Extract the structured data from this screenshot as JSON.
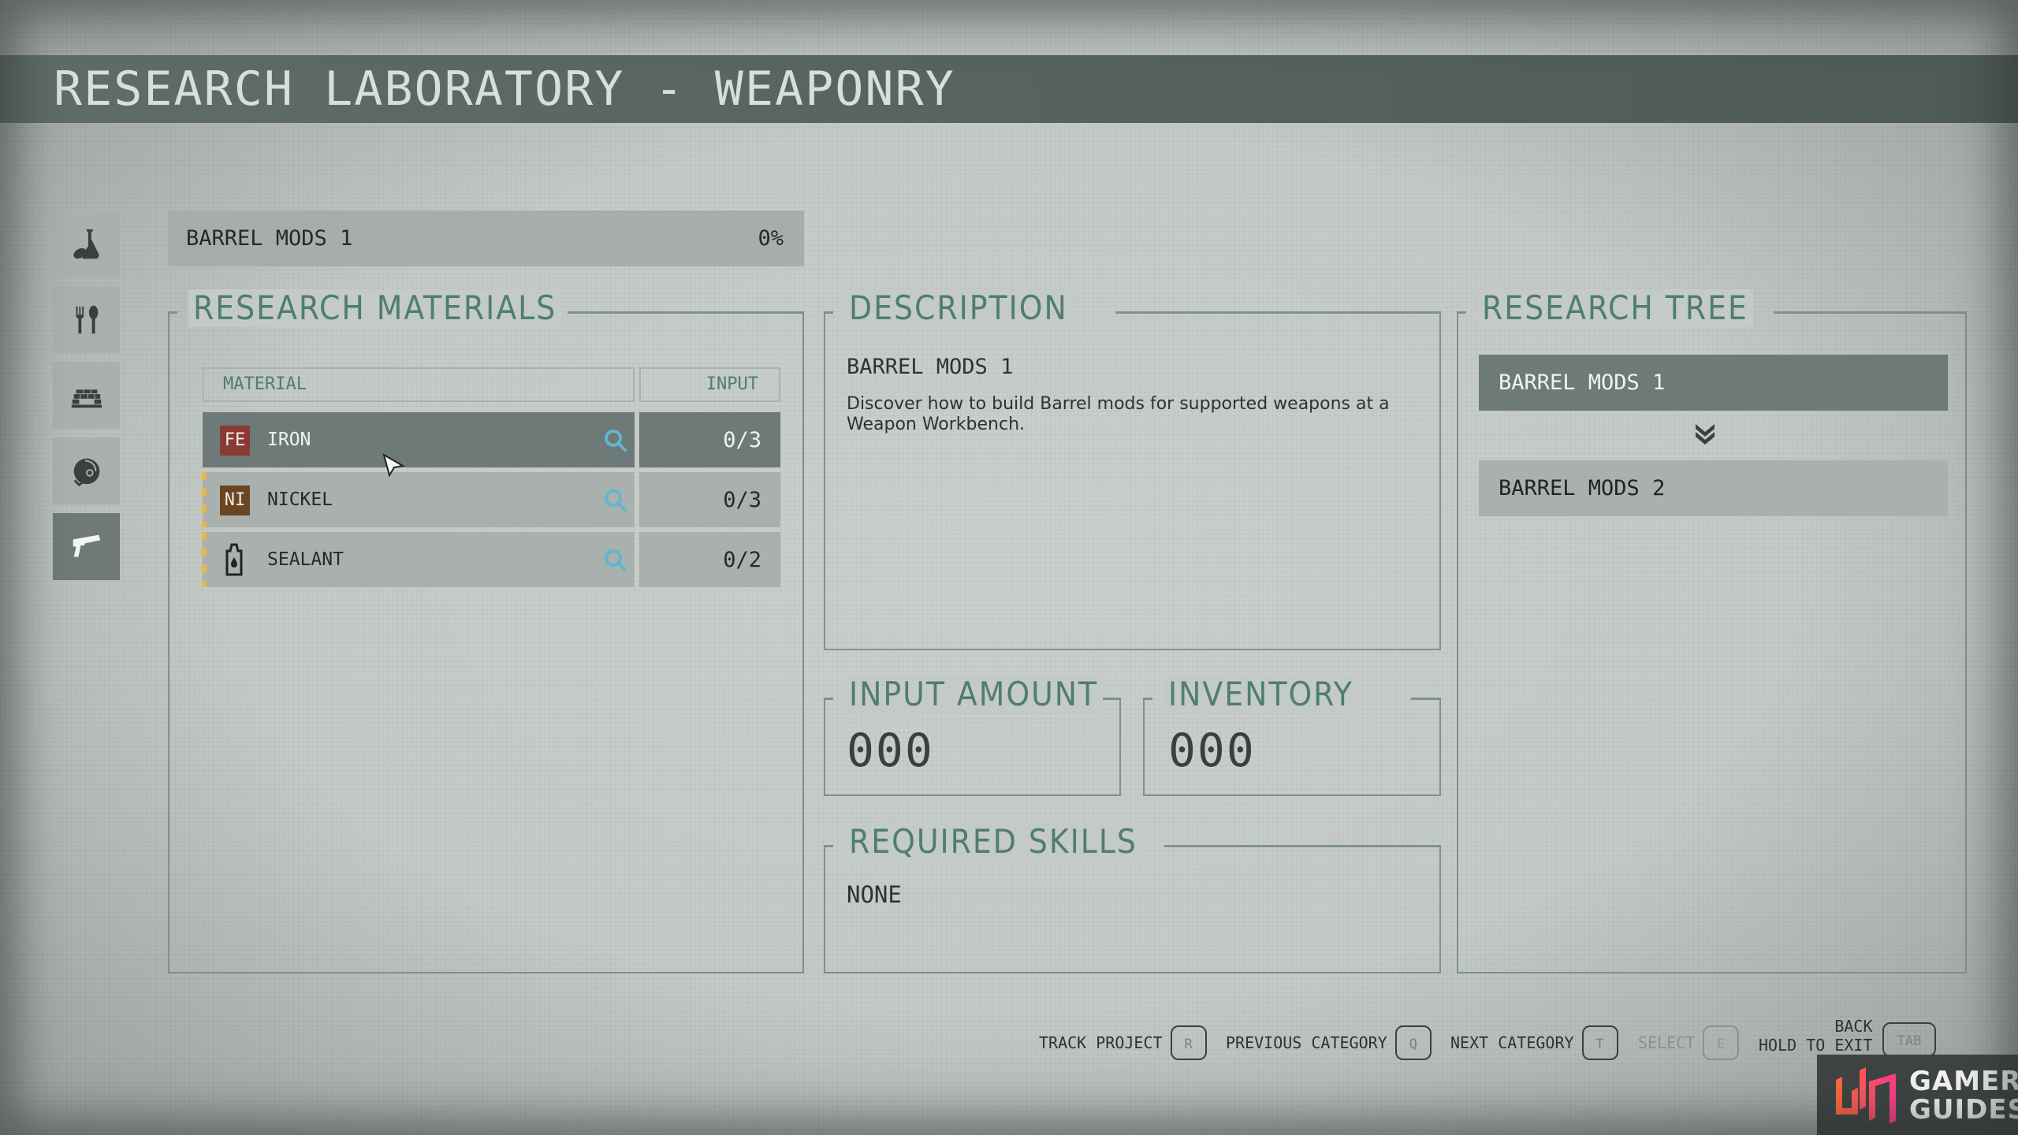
{
  "header": {
    "title": "RESEARCH LABORATORY - WEAPONRY"
  },
  "sidebar": {
    "items": [
      {
        "name": "pharmacology",
        "icon": "flask-pills-icon",
        "active": false
      },
      {
        "name": "food-and-drink",
        "icon": "fork-spoon-icon",
        "active": false
      },
      {
        "name": "outpost-development",
        "icon": "bricks-icon",
        "active": false
      },
      {
        "name": "equipment",
        "icon": "helmet-icon",
        "active": false
      },
      {
        "name": "weaponry",
        "icon": "pistol-icon",
        "active": true
      }
    ]
  },
  "project": {
    "name": "BARREL MODS 1",
    "progress": "0%"
  },
  "materials": {
    "title": "RESEARCH MATERIALS",
    "columns": {
      "material": "MATERIAL",
      "input": "INPUT"
    },
    "rows": [
      {
        "badge": "FE",
        "badge_color": "#8a3a35",
        "name": "IRON",
        "input": "0/3",
        "selected": true
      },
      {
        "badge": "NI",
        "badge_color": "#6b4522",
        "name": "NICKEL",
        "input": "0/3",
        "selected": false
      },
      {
        "badge": "",
        "icon": "sealant-bottle-icon",
        "name": "SEALANT",
        "input": "0/2",
        "selected": false
      }
    ]
  },
  "description": {
    "title": "DESCRIPTION",
    "heading": "BARREL MODS 1",
    "text": "Discover how to build Barrel mods for supported weapons at a Weapon Workbench."
  },
  "input_amount": {
    "title": "INPUT AMOUNT",
    "value": "000"
  },
  "inventory": {
    "title": "INVENTORY",
    "value": "000"
  },
  "required_skills": {
    "title": "REQUIRED SKILLS",
    "value": "NONE"
  },
  "research_tree": {
    "title": "RESEARCH TREE",
    "nodes": [
      {
        "label": "BARREL MODS 1",
        "state": "current"
      },
      {
        "label": "BARREL MODS 2",
        "state": "locked"
      }
    ]
  },
  "footer": {
    "hints": [
      {
        "label": "TRACK PROJECT",
        "key": "R",
        "enabled": true
      },
      {
        "label": "PREVIOUS CATEGORY",
        "key": "Q",
        "enabled": true
      },
      {
        "label": "NEXT CATEGORY",
        "key": "T",
        "enabled": true
      },
      {
        "label": "SELECT",
        "key": "E",
        "enabled": false
      }
    ],
    "back": {
      "label_top": "BACK",
      "label_bottom": "HOLD TO EXIT",
      "key": "TAB"
    }
  },
  "watermark": {
    "line1": "GAMER",
    "line2": "GUIDES"
  },
  "colors": {
    "accent_green": "#4f7e6e",
    "selected_row": "#6e7a78",
    "search_icon": "#5fb6cf",
    "warning_stripe": "#e8b84a"
  }
}
